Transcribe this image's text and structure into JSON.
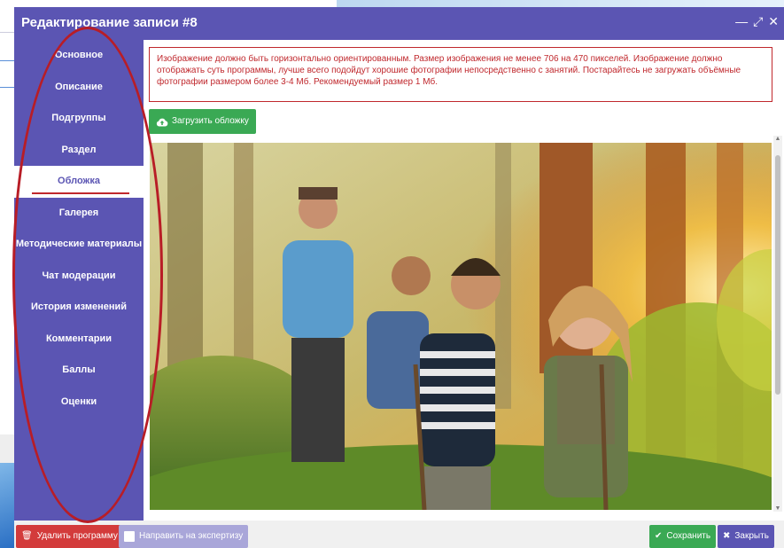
{
  "dialog": {
    "title": "Редактирование записи #8",
    "minimize_icon": "minimize-icon",
    "maximize_icon": "maximize-icon",
    "close_icon": "close-icon"
  },
  "sidebar": {
    "items": [
      {
        "label": "Основное"
      },
      {
        "label": "Описание"
      },
      {
        "label": "Подгруппы"
      },
      {
        "label": "Раздел"
      },
      {
        "label": "Обложка",
        "active": true
      },
      {
        "label": "Галерея"
      },
      {
        "label": "Методические материалы"
      },
      {
        "label": "Чат модерации"
      },
      {
        "label": "История изменений"
      },
      {
        "label": "Комментарии"
      },
      {
        "label": "Баллы"
      },
      {
        "label": "Оценки"
      }
    ]
  },
  "content": {
    "alert_text": "Изображение должно быть горизонтально ориентированным. Размер изображения не менее 706 на 470 пикселей. Изображение должно отображать суть программы, лучше всего подойдут хорошие фотографии непосредственно с занятий. Постарайтесь не загружать объёмные фотографии размером более 3-4 Мб. Рекомендуемый размер 1 Мб.",
    "upload_label": "Загрузить обложку",
    "upload_icon": "cloud-upload-icon"
  },
  "footer": {
    "delete_label": "Удалить программу",
    "expert_label": "Направить на экспертизу",
    "save_label": "Сохранить",
    "close_label": "Закрыть"
  },
  "colors": {
    "primary": "#5b55b3",
    "success": "#3aa954",
    "danger": "#d33b3b",
    "annotation": "#b81d26"
  }
}
